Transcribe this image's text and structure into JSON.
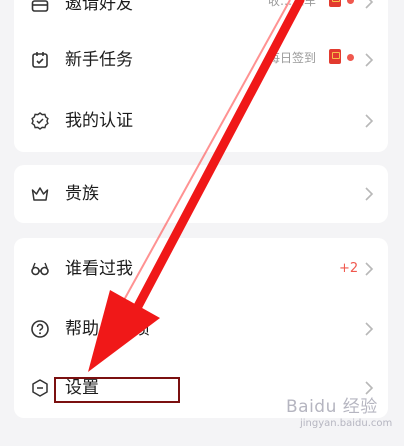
{
  "group1": {
    "invite": {
      "label": "邀请好友",
      "right_text": "收…工车"
    },
    "newbie": {
      "label": "新手任务",
      "right_text": "每日签到"
    },
    "verify": {
      "label": "我的认证"
    }
  },
  "group2": {
    "noble": {
      "label": "贵族"
    }
  },
  "group3": {
    "visitors": {
      "label": "谁看过我",
      "count": "+2"
    },
    "feedback": {
      "label": "帮助与反馈"
    },
    "settings": {
      "label": "设置"
    }
  },
  "watermark": {
    "brand": "Baidu 经验",
    "url": "jingyan.baidu.com"
  },
  "colors": {
    "accent_red": "#e23b2f",
    "dot_red": "#f0584e",
    "arrow_red": "#f01818",
    "box_border": "#7b1010"
  }
}
